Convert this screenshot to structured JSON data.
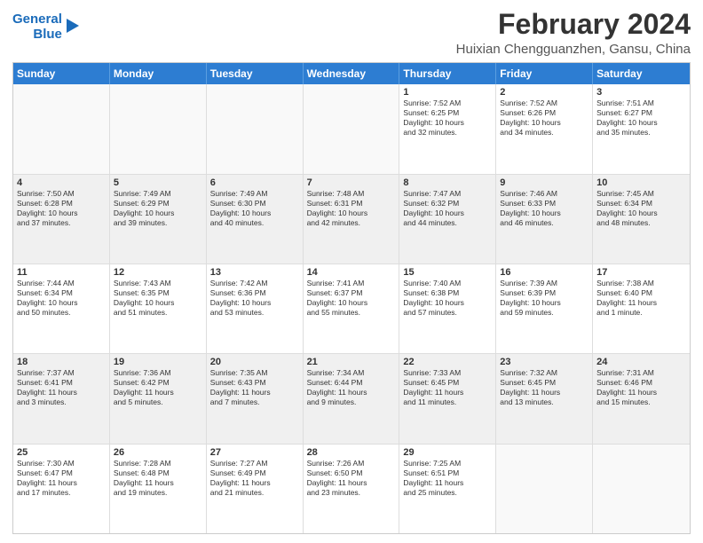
{
  "logo": {
    "line1": "General",
    "line2": "Blue"
  },
  "title": "February 2024",
  "location": "Huixian Chengguanzhen, Gansu, China",
  "weekdays": [
    "Sunday",
    "Monday",
    "Tuesday",
    "Wednesday",
    "Thursday",
    "Friday",
    "Saturday"
  ],
  "weeks": [
    [
      {
        "day": "",
        "info": ""
      },
      {
        "day": "",
        "info": ""
      },
      {
        "day": "",
        "info": ""
      },
      {
        "day": "",
        "info": ""
      },
      {
        "day": "1",
        "info": "Sunrise: 7:52 AM\nSunset: 6:25 PM\nDaylight: 10 hours\nand 32 minutes."
      },
      {
        "day": "2",
        "info": "Sunrise: 7:52 AM\nSunset: 6:26 PM\nDaylight: 10 hours\nand 34 minutes."
      },
      {
        "day": "3",
        "info": "Sunrise: 7:51 AM\nSunset: 6:27 PM\nDaylight: 10 hours\nand 35 minutes."
      }
    ],
    [
      {
        "day": "4",
        "info": "Sunrise: 7:50 AM\nSunset: 6:28 PM\nDaylight: 10 hours\nand 37 minutes."
      },
      {
        "day": "5",
        "info": "Sunrise: 7:49 AM\nSunset: 6:29 PM\nDaylight: 10 hours\nand 39 minutes."
      },
      {
        "day": "6",
        "info": "Sunrise: 7:49 AM\nSunset: 6:30 PM\nDaylight: 10 hours\nand 40 minutes."
      },
      {
        "day": "7",
        "info": "Sunrise: 7:48 AM\nSunset: 6:31 PM\nDaylight: 10 hours\nand 42 minutes."
      },
      {
        "day": "8",
        "info": "Sunrise: 7:47 AM\nSunset: 6:32 PM\nDaylight: 10 hours\nand 44 minutes."
      },
      {
        "day": "9",
        "info": "Sunrise: 7:46 AM\nSunset: 6:33 PM\nDaylight: 10 hours\nand 46 minutes."
      },
      {
        "day": "10",
        "info": "Sunrise: 7:45 AM\nSunset: 6:34 PM\nDaylight: 10 hours\nand 48 minutes."
      }
    ],
    [
      {
        "day": "11",
        "info": "Sunrise: 7:44 AM\nSunset: 6:34 PM\nDaylight: 10 hours\nand 50 minutes."
      },
      {
        "day": "12",
        "info": "Sunrise: 7:43 AM\nSunset: 6:35 PM\nDaylight: 10 hours\nand 51 minutes."
      },
      {
        "day": "13",
        "info": "Sunrise: 7:42 AM\nSunset: 6:36 PM\nDaylight: 10 hours\nand 53 minutes."
      },
      {
        "day": "14",
        "info": "Sunrise: 7:41 AM\nSunset: 6:37 PM\nDaylight: 10 hours\nand 55 minutes."
      },
      {
        "day": "15",
        "info": "Sunrise: 7:40 AM\nSunset: 6:38 PM\nDaylight: 10 hours\nand 57 minutes."
      },
      {
        "day": "16",
        "info": "Sunrise: 7:39 AM\nSunset: 6:39 PM\nDaylight: 10 hours\nand 59 minutes."
      },
      {
        "day": "17",
        "info": "Sunrise: 7:38 AM\nSunset: 6:40 PM\nDaylight: 11 hours\nand 1 minute."
      }
    ],
    [
      {
        "day": "18",
        "info": "Sunrise: 7:37 AM\nSunset: 6:41 PM\nDaylight: 11 hours\nand 3 minutes."
      },
      {
        "day": "19",
        "info": "Sunrise: 7:36 AM\nSunset: 6:42 PM\nDaylight: 11 hours\nand 5 minutes."
      },
      {
        "day": "20",
        "info": "Sunrise: 7:35 AM\nSunset: 6:43 PM\nDaylight: 11 hours\nand 7 minutes."
      },
      {
        "day": "21",
        "info": "Sunrise: 7:34 AM\nSunset: 6:44 PM\nDaylight: 11 hours\nand 9 minutes."
      },
      {
        "day": "22",
        "info": "Sunrise: 7:33 AM\nSunset: 6:45 PM\nDaylight: 11 hours\nand 11 minutes."
      },
      {
        "day": "23",
        "info": "Sunrise: 7:32 AM\nSunset: 6:45 PM\nDaylight: 11 hours\nand 13 minutes."
      },
      {
        "day": "24",
        "info": "Sunrise: 7:31 AM\nSunset: 6:46 PM\nDaylight: 11 hours\nand 15 minutes."
      }
    ],
    [
      {
        "day": "25",
        "info": "Sunrise: 7:30 AM\nSunset: 6:47 PM\nDaylight: 11 hours\nand 17 minutes."
      },
      {
        "day": "26",
        "info": "Sunrise: 7:28 AM\nSunset: 6:48 PM\nDaylight: 11 hours\nand 19 minutes."
      },
      {
        "day": "27",
        "info": "Sunrise: 7:27 AM\nSunset: 6:49 PM\nDaylight: 11 hours\nand 21 minutes."
      },
      {
        "day": "28",
        "info": "Sunrise: 7:26 AM\nSunset: 6:50 PM\nDaylight: 11 hours\nand 23 minutes."
      },
      {
        "day": "29",
        "info": "Sunrise: 7:25 AM\nSunset: 6:51 PM\nDaylight: 11 hours\nand 25 minutes."
      },
      {
        "day": "",
        "info": ""
      },
      {
        "day": "",
        "info": ""
      }
    ]
  ]
}
